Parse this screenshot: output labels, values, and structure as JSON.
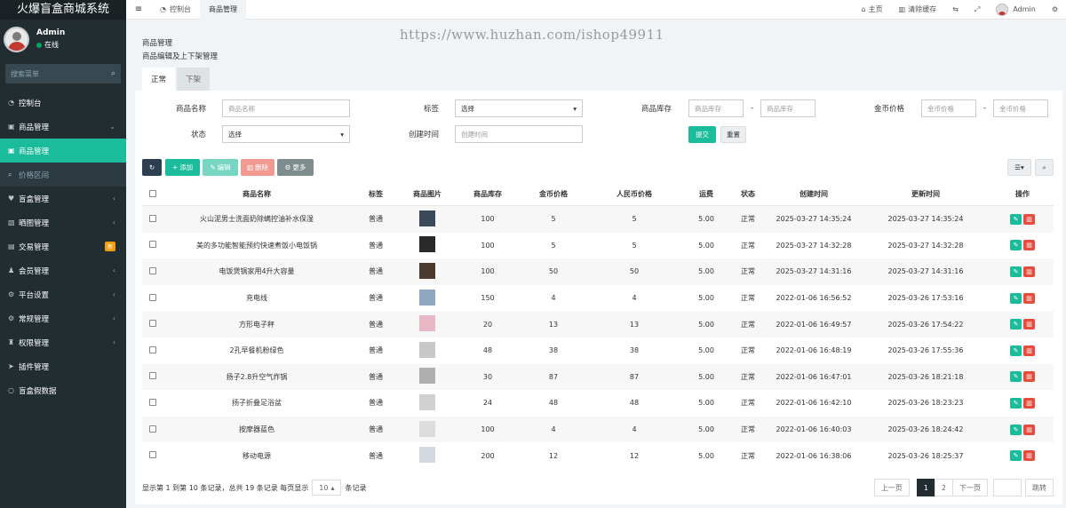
{
  "app": {
    "title": "火爆盲盒商城系统"
  },
  "user": {
    "name": "Admin",
    "status": "在线"
  },
  "sidebar": {
    "search_placeholder": "搜索菜单",
    "items": [
      {
        "label": "控制台",
        "icon": "dashboard-icon"
      },
      {
        "label": "商品管理",
        "icon": "gift-icon",
        "arrow": "⌄"
      },
      {
        "label": "商品管理",
        "icon": "gift-icon",
        "active": true
      },
      {
        "label": "价格区间",
        "icon": "search-icon",
        "sub": true
      },
      {
        "label": "盲盒管理",
        "icon": "heart-icon",
        "arrow": "‹"
      },
      {
        "label": "晒图管理",
        "icon": "image-icon",
        "arrow": "‹"
      },
      {
        "label": "交易管理",
        "icon": "cart-icon",
        "badge": "新"
      },
      {
        "label": "会员管理",
        "icon": "user-icon",
        "arrow": "‹"
      },
      {
        "label": "平台设置",
        "icon": "gear-icon",
        "arrow": "‹"
      },
      {
        "label": "常规管理",
        "icon": "cog-icon",
        "arrow": "‹"
      },
      {
        "label": "权限管理",
        "icon": "group-icon",
        "arrow": "‹"
      },
      {
        "label": "插件管理",
        "icon": "rocket-icon"
      },
      {
        "label": "盲盒假数据",
        "icon": "circle-icon"
      }
    ]
  },
  "topbar": {
    "tabs": [
      "控制台",
      "商品管理"
    ],
    "home": "主页",
    "clear_cache": "清除缓存",
    "admin": "Admin"
  },
  "watermark": "https://www.huzhan.com/ishop49911",
  "page": {
    "title": "商品管理",
    "desc": "商品编辑及上下架管理",
    "tabs": [
      "正常",
      "下架"
    ]
  },
  "filters": {
    "name_label": "商品名称",
    "name_placeholder": "商品名称",
    "tag_label": "标签",
    "tag_value": "选择",
    "stock_label": "商品库存",
    "stock_placeholder": "商品库存",
    "dash": "-",
    "gold_label": "金币价格",
    "gold_placeholder": "金币价格",
    "status_label": "状态",
    "status_value": "选择",
    "created_label": "创建时间",
    "created_placeholder": "创建时间",
    "submit": "提交",
    "reset": "重置"
  },
  "toolbar": {
    "add": "添加",
    "edit": "编辑",
    "delete": "删除",
    "more": "更多"
  },
  "table": {
    "headers": [
      "商品名称",
      "标签",
      "商品图片",
      "商品库存",
      "金币价格",
      "人民币价格",
      "运费",
      "状态",
      "创建时间",
      "更新时间",
      "操作"
    ],
    "rows": [
      {
        "name": "火山泥男士洗面奶除螨控油补水保湿",
        "tag": "普通",
        "stock": "100",
        "gold": "5",
        "rmb": "5",
        "ship": "5.00",
        "status": "正常",
        "created": "2025-03-27 14:35:24",
        "updated": "2025-03-27 14:35:24",
        "thumb": "#3a4a5a"
      },
      {
        "name": "美的多功能智能预约快速煮饭小电饭锅",
        "tag": "普通",
        "stock": "100",
        "gold": "5",
        "rmb": "5",
        "ship": "5.00",
        "status": "正常",
        "created": "2025-03-27 14:32:28",
        "updated": "2025-03-27 14:32:28",
        "thumb": "#2a2a2a"
      },
      {
        "name": "电饭煲锅家用4升大容量",
        "tag": "普通",
        "stock": "100",
        "gold": "50",
        "rmb": "50",
        "ship": "5.00",
        "status": "正常",
        "created": "2025-03-27 14:31:16",
        "updated": "2025-03-27 14:31:16",
        "thumb": "#4a3a30"
      },
      {
        "name": "充电线",
        "tag": "普通",
        "stock": "150",
        "gold": "4",
        "rmb": "4",
        "ship": "5.00",
        "status": "正常",
        "created": "2022-01-06 16:56:52",
        "updated": "2025-03-26 17:53:16",
        "thumb": "#8fa8c0"
      },
      {
        "name": "方形电子秤",
        "tag": "普通",
        "stock": "20",
        "gold": "13",
        "rmb": "13",
        "ship": "5.00",
        "status": "正常",
        "created": "2022-01-06 16:49:57",
        "updated": "2025-03-26 17:54:22",
        "thumb": "#e8b8c4"
      },
      {
        "name": "2孔早餐机粉绿色",
        "tag": "普通",
        "stock": "48",
        "gold": "38",
        "rmb": "38",
        "ship": "5.00",
        "status": "正常",
        "created": "2022-01-06 16:48:19",
        "updated": "2025-03-26 17:55:36",
        "thumb": "#c8c8c8"
      },
      {
        "name": "扬子2.8升空气炸锅",
        "tag": "普通",
        "stock": "30",
        "gold": "87",
        "rmb": "87",
        "ship": "5.00",
        "status": "正常",
        "created": "2022-01-06 16:47:01",
        "updated": "2025-03-26 18:21:18",
        "thumb": "#b0b0b0"
      },
      {
        "name": "扬子折叠足浴盆",
        "tag": "普通",
        "stock": "24",
        "gold": "48",
        "rmb": "48",
        "ship": "5.00",
        "status": "正常",
        "created": "2022-01-06 16:42:10",
        "updated": "2025-03-26 18:23:23",
        "thumb": "#d0d0d0"
      },
      {
        "name": "按摩器蓝色",
        "tag": "普通",
        "stock": "100",
        "gold": "4",
        "rmb": "4",
        "ship": "5.00",
        "status": "正常",
        "created": "2022-01-06 16:40:03",
        "updated": "2025-03-26 18:24:42",
        "thumb": "#dcdcdc"
      },
      {
        "name": "移动电源",
        "tag": "普通",
        "stock": "200",
        "gold": "12",
        "rmb": "12",
        "ship": "5.00",
        "status": "正常",
        "created": "2022-01-06 16:38:06",
        "updated": "2025-03-26 18:25:37",
        "thumb": "#d4d8e0"
      }
    ]
  },
  "footer": {
    "summary": "显示第 1 到第 10 条记录，总共 19 条记录 每页显示",
    "page_size": "10",
    "page_size_suffix": "条记录",
    "prev": "上一页",
    "pages": [
      "1",
      "2"
    ],
    "next": "下一页",
    "jump": "跳转"
  },
  "colors": {
    "sidebar": "#222d32",
    "accent": "#1abc9c",
    "danger": "#e74c3c",
    "dark": "#222d32"
  }
}
